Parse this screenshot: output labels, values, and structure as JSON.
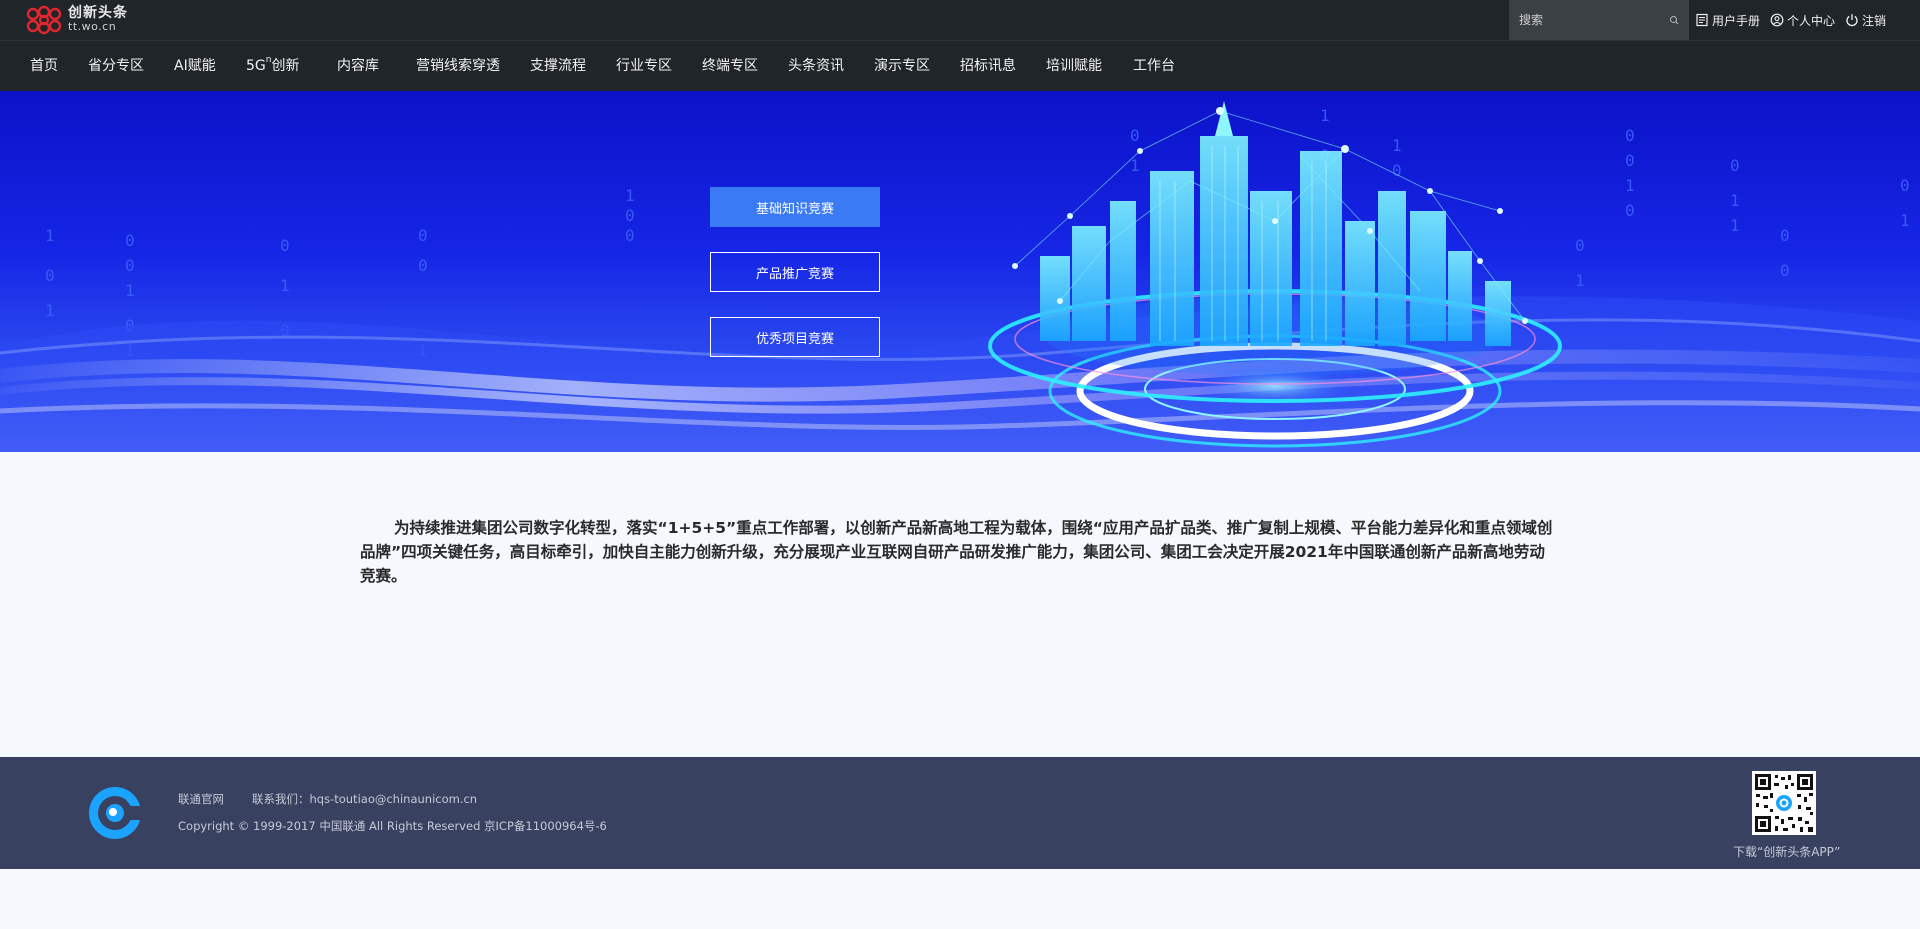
{
  "brand": {
    "name_cn": "创新头条",
    "domain": "tt.wo.cn"
  },
  "search": {
    "placeholder": "搜索"
  },
  "user_links": [
    {
      "label": "用户手册",
      "icon": "document-icon"
    },
    {
      "label": "个人中心",
      "icon": "user-icon"
    },
    {
      "label": "注销",
      "icon": "power-icon"
    }
  ],
  "nav": {
    "items": [
      "首页",
      "省分专区",
      "AI赋能",
      "5G",
      "创新",
      "内容库",
      "营销线索穿透",
      "支撑流程",
      "行业专区",
      "终端专区",
      "头条资讯",
      "演示专区",
      "招标讯息",
      "培训赋能",
      "工作台"
    ],
    "sup_n": "n"
  },
  "banner": {
    "buttons": [
      {
        "label": "基础知识竞赛",
        "active": true
      },
      {
        "label": "产品推广竞赛",
        "active": false
      },
      {
        "label": "优秀项目竞赛",
        "active": false
      }
    ]
  },
  "intro": {
    "text": "为持续推进集团公司数字化转型，落实“1+5+5”重点工作部署，以创新产品新高地工程为载体，围绕“应用产品扩品类、推广复制上规模、平台能力差异化和重点领域创品牌”四项关键任务，高目标牵引，加快自主能力创新升级，充分展现产业互联网自研产品研发推广能力，集团公司、集团工会决定开展2021年中国联通创新产品新高地劳动竞赛。"
  },
  "footer": {
    "links": [
      "联通官网",
      "联系我们：hqs-toutiao@chinaunicom.cn"
    ],
    "copyright": "Copyright © 1999-2017 中国联通 All Rights Reserved 京ICP备11000964号-6",
    "qr_caption": "下载“创新头条APP”"
  }
}
